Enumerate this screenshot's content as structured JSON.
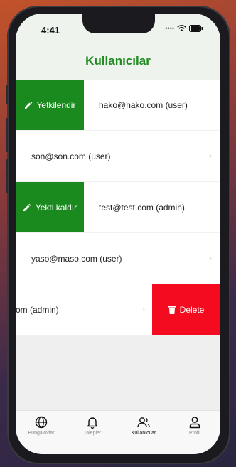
{
  "status": {
    "time": "4:41"
  },
  "header": {
    "title": "Kullanıcılar"
  },
  "rows": [
    {
      "action_label": "Yetkilendir",
      "user_text": "hako@hako.com  (user)"
    },
    {
      "user_text": "son@son.com  (user)"
    },
    {
      "action_label": "Yekti kaldır",
      "user_text": "test@test.com  (admin)"
    },
    {
      "user_text": "yaso@maso.com  (user)"
    },
    {
      "user_text_partial": "om  (admin)",
      "action_label": "Delete"
    }
  ],
  "tabs": [
    {
      "label": "Bungalovlar",
      "icon": "globe-icon"
    },
    {
      "label": "Talepler",
      "icon": "bell-icon"
    },
    {
      "label": "Kullanıcılar",
      "icon": "users-icon"
    },
    {
      "label": "Profil",
      "icon": "person-icon"
    }
  ],
  "colors": {
    "green": "#1a8a1e",
    "red": "#f40b1f",
    "title": "#1f8a1f"
  }
}
